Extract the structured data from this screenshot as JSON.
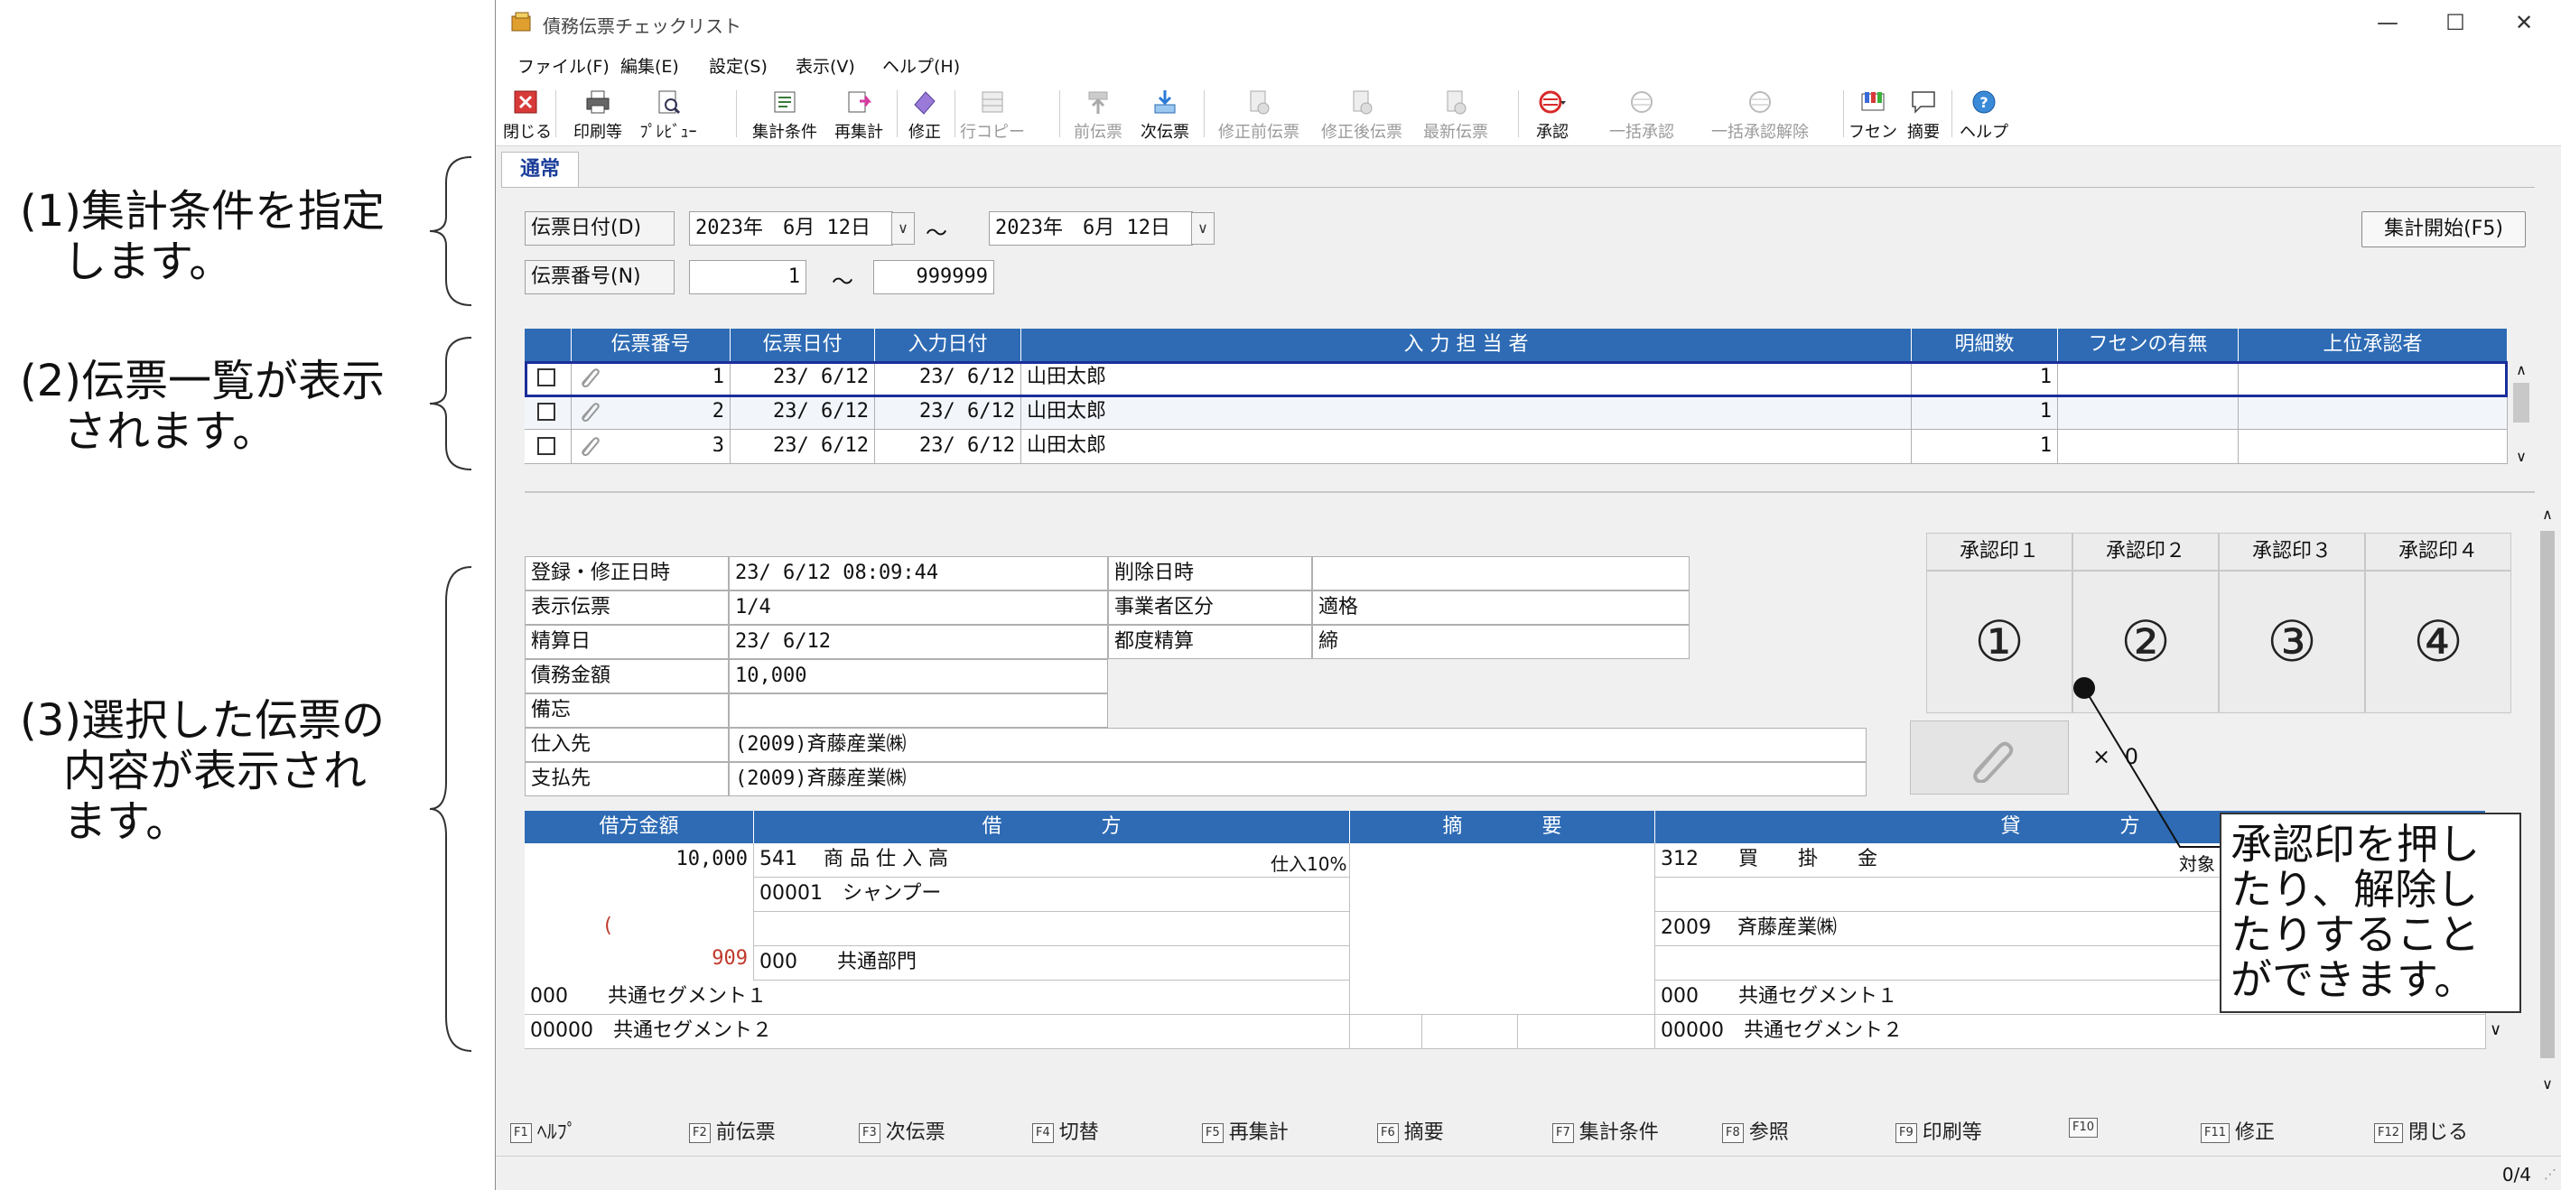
{
  "annotations": [
    {
      "text": "(1)集計条件を指定\n　します。"
    },
    {
      "text": "(2)伝票一覧が表示\n　されます。"
    },
    {
      "text": "(3)選択した伝票の\n　内容が表示され\n　ます。"
    }
  ],
  "callout": "承認印を押し\nたり、解除し\nたりすること\nができます。",
  "window": {
    "title": "債務伝票チェックリスト",
    "controls": {
      "minimize": "—",
      "maximize": "☐",
      "close": "✕"
    }
  },
  "menu": [
    "ファイル(F)",
    "編集(E)",
    "設定(S)",
    "表示(V)",
    "ヘルプ(H)"
  ],
  "toolbar": [
    {
      "label": "閉じる",
      "icon": "close-icon",
      "enabled": true
    },
    {
      "label": "印刷等",
      "icon": "printer-icon",
      "enabled": true
    },
    {
      "label": "ﾌﾟﾚﾋﾞｭｰ",
      "icon": "preview-icon",
      "enabled": true
    },
    {
      "label": "集計条件",
      "icon": "conditions-icon",
      "enabled": true
    },
    {
      "label": "再集計",
      "icon": "recalc-icon",
      "enabled": true
    },
    {
      "label": "修正",
      "icon": "eraser-icon",
      "enabled": true
    },
    {
      "label": "行コピー",
      "icon": "row-copy-icon",
      "enabled": false
    },
    {
      "label": "前伝票",
      "icon": "prev-slip-icon",
      "enabled": false
    },
    {
      "label": "次伝票",
      "icon": "next-slip-icon",
      "enabled": true
    },
    {
      "label": "修正前伝票",
      "icon": "before-edit-icon",
      "enabled": false
    },
    {
      "label": "修正後伝票",
      "icon": "after-edit-icon",
      "enabled": false
    },
    {
      "label": "最新伝票",
      "icon": "latest-slip-icon",
      "enabled": false
    },
    {
      "label": "承認",
      "icon": "approve-stamp-icon",
      "enabled": true
    },
    {
      "label": "一括承認",
      "icon": "bulk-approve-icon",
      "enabled": false
    },
    {
      "label": "一括承認解除",
      "icon": "bulk-unapprove-icon",
      "enabled": false
    },
    {
      "label": "フセン",
      "icon": "sticky-note-icon",
      "enabled": true
    },
    {
      "label": "摘要",
      "icon": "memo-bubble-icon",
      "enabled": true
    },
    {
      "label": "ヘルプ",
      "icon": "help-icon",
      "enabled": true
    }
  ],
  "tab": "通常",
  "conditions": {
    "date_label": "伝票日付(D)",
    "date_from": "2023年　6月 12日",
    "date_to": "2023年　6月 12日",
    "number_label": "伝票番号(N)",
    "number_from": "1",
    "number_to": "999999",
    "tilde": "～",
    "start_button": "集計開始(F5)"
  },
  "list": {
    "headers": [
      "伝票番号",
      "伝票日付",
      "入力日付",
      "入 力 担 当 者",
      "明細数",
      "フセンの有無",
      "上位承認者"
    ],
    "rows": [
      {
        "number": "1",
        "slip_date": "23/ 6/12",
        "input_date": "23/ 6/12",
        "person": "山田太郎",
        "lines": "1",
        "sticky": "",
        "approver": ""
      },
      {
        "number": "2",
        "slip_date": "23/ 6/12",
        "input_date": "23/ 6/12",
        "person": "山田太郎",
        "lines": "1",
        "sticky": "",
        "approver": ""
      },
      {
        "number": "3",
        "slip_date": "23/ 6/12",
        "input_date": "23/ 6/12",
        "person": "山田太郎",
        "lines": "1",
        "sticky": "",
        "approver": ""
      }
    ]
  },
  "detail": {
    "registered_label": "登録・修正日時",
    "registered": "23/ 6/12 08:09:44",
    "deleted_label": "削除日時",
    "deleted": "",
    "display_label": "表示伝票",
    "display": "1/4",
    "business_label": "事業者区分",
    "business": "適格",
    "settle_label": "精算日",
    "settle": "23/ 6/12",
    "each_label": "都度精算",
    "each": "締",
    "amount_label": "債務金額",
    "amount": "10,000",
    "memo_label": "備忘",
    "memo": "",
    "supplier_label": "仕入先",
    "supplier": "(2009)斉藤産業㈱",
    "payee_label": "支払先",
    "payee": "(2009)斉藤産業㈱"
  },
  "stamps": {
    "headers": [
      "承認印１",
      "承認印２",
      "承認印３",
      "承認印４"
    ],
    "marks": [
      "①",
      "②",
      "③",
      "④"
    ],
    "attach_count_prefix": "×",
    "attach_count": "0"
  },
  "journal": {
    "headers": [
      "借方金額",
      "借　　　　　方",
      "摘　　　　要",
      "貸　　　　　方"
    ],
    "debit_amount": "10,000",
    "tax_amount": "909",
    "tax_paren": "(",
    "debit_account": "541　 商 品 仕 入 高",
    "debit_tax": "仕入10%",
    "debit_sub": "00001　シャンプー",
    "debit_dept": "000　　共通部門",
    "debit_seg1": "000　　共通セグメント１",
    "debit_seg2": "00000　共通セグメント２",
    "credit_account": "312　　買　　掛　　金",
    "credit_tax": "対象",
    "credit_sub": "2009　 斉藤産業㈱",
    "credit_seg1": "000　　共通セグメント１",
    "credit_seg2": "00000　共通セグメント２"
  },
  "function_keys": [
    {
      "key": "F1",
      "label": "ﾍﾙﾌﾟ"
    },
    {
      "key": "F2",
      "label": "前伝票"
    },
    {
      "key": "F3",
      "label": "次伝票"
    },
    {
      "key": "F4",
      "label": "切替"
    },
    {
      "key": "F5",
      "label": "再集計"
    },
    {
      "key": "F6",
      "label": "摘要"
    },
    {
      "key": "F7",
      "label": "集計条件"
    },
    {
      "key": "F8",
      "label": "参照"
    },
    {
      "key": "F9",
      "label": "印刷等"
    },
    {
      "key": "F10",
      "label": ""
    },
    {
      "key": "F11",
      "label": "修正"
    },
    {
      "key": "F12",
      "label": "閉じる"
    }
  ],
  "status": {
    "page": "0/4"
  },
  "colors": {
    "header_blue": "#2e6bb4",
    "selection_border": "#1a2f9a",
    "tax_red": "#c0392b"
  }
}
